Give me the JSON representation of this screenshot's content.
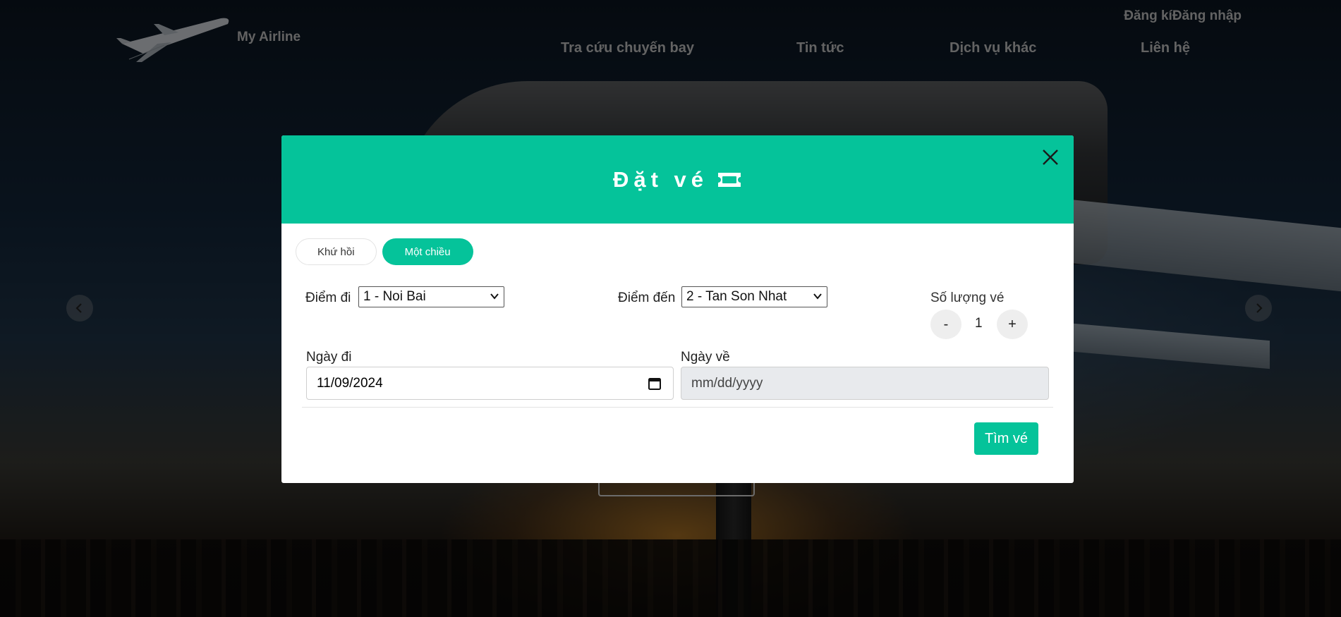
{
  "header": {
    "brand": "My Airline",
    "auth": {
      "register": "Đăng kí",
      "login": "Đăng nhập"
    },
    "nav": [
      {
        "label": "Tra cứu chuyến bay"
      },
      {
        "label": "Tin tức"
      },
      {
        "label": "Dịch vụ khác"
      },
      {
        "label": "Liên hệ"
      }
    ]
  },
  "carousel": {
    "prev_icon": "chevron-left-icon",
    "next_icon": "chevron-right-icon"
  },
  "modal": {
    "title": "Đặt vé",
    "title_icon": "ticket-icon",
    "close_icon": "close-icon",
    "tabs": [
      {
        "label": "Khứ hồi",
        "active": false
      },
      {
        "label": "Một chiều",
        "active": true
      }
    ],
    "origin": {
      "label": "Điểm đi",
      "value": "1 - Noi Bai"
    },
    "destination": {
      "label": "Điểm đến",
      "value": "2 - Tan Son Nhat"
    },
    "quantity": {
      "label": "Số lượng vé",
      "value": "1",
      "minus": "-",
      "plus": "+"
    },
    "depart_date": {
      "label": "Ngày đi",
      "value": "11/09/2024"
    },
    "return_date": {
      "label": "Ngày về",
      "placeholder": "mm/dd/yyyy",
      "disabled": true
    },
    "submit_label": "Tìm vé"
  },
  "colors": {
    "accent": "#05c39a",
    "nav_text": "#c7c7c7"
  }
}
